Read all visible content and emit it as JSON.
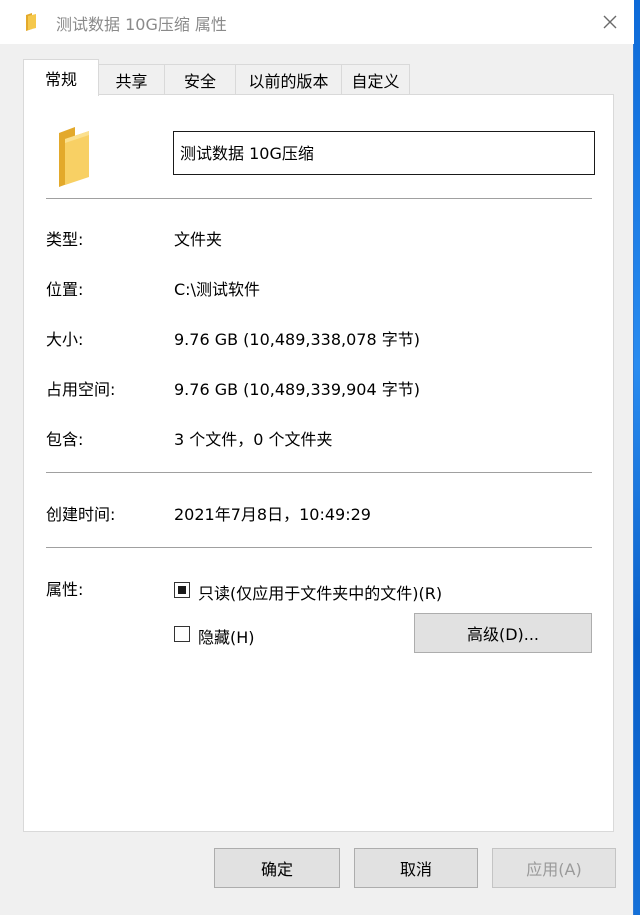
{
  "window": {
    "title": "测试数据 10G压缩 属性",
    "close_label": "×"
  },
  "tabs": [
    {
      "label": "常规",
      "active": true
    },
    {
      "label": "共享",
      "active": false
    },
    {
      "label": "安全",
      "active": false
    },
    {
      "label": "以前的版本",
      "active": false
    },
    {
      "label": "自定义",
      "active": false
    }
  ],
  "general": {
    "name_value": "测试数据 10G压缩",
    "rows": [
      {
        "label": "类型:",
        "value": "文件夹"
      },
      {
        "label": "位置:",
        "value": "C:\\测试软件"
      },
      {
        "label": "大小:",
        "value": "9.76 GB (10,489,338,078 字节)"
      },
      {
        "label": "占用空间:",
        "value": "9.76 GB (10,489,339,904 字节)"
      },
      {
        "label": "包含:",
        "value": "3 个文件，0 个文件夹"
      }
    ],
    "created": {
      "label": "创建时间:",
      "value": "2021年7月8日，10:49:29"
    },
    "attributes": {
      "label": "属性:",
      "readonly": {
        "label": "只读(仅应用于文件夹中的文件)(R)",
        "checked": true
      },
      "hidden": {
        "label": "隐藏(H)",
        "checked": false
      },
      "advanced_label": "高级(D)..."
    }
  },
  "footer": {
    "ok_label": "确定",
    "cancel_label": "取消",
    "apply_label": "应用(A)"
  },
  "colors": {
    "folder": "#f5c84c",
    "folder_dark": "#e3a92b",
    "desktop": "#1f78d1"
  }
}
